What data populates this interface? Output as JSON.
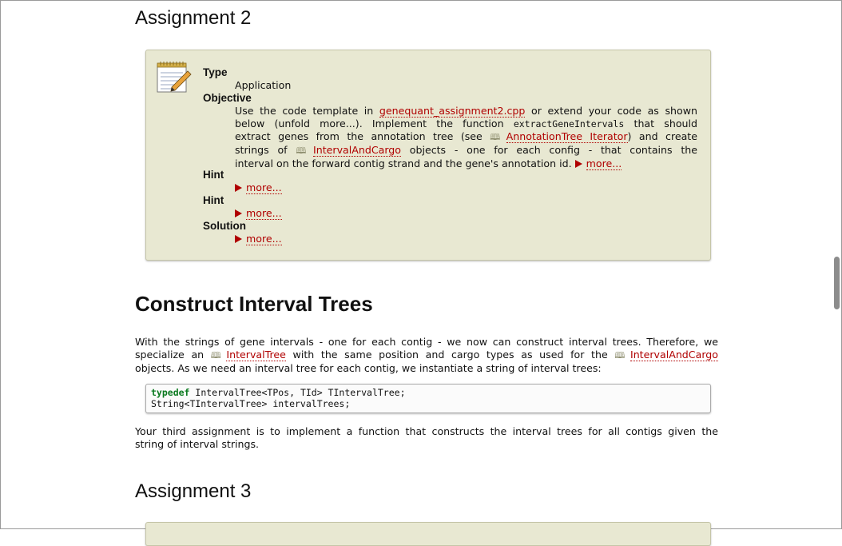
{
  "headings": {
    "assignment2": "Assignment 2",
    "construct": "Construct Interval Trees",
    "assignment3": "Assignment 3"
  },
  "assignment2": {
    "type_label": "Type",
    "type_value": "Application",
    "objective_label": "Objective",
    "objective": {
      "l1a": "Use the code template in ",
      "l1_link": "genequant_assignment2.cpp",
      "l1b": " or extend your code as shown",
      "l2a": "below (unfold more...). Implement the function ",
      "l2_code": "extractGeneIntervals",
      "l2b": " that should",
      "l3a": "extract genes from the annotation tree (see ",
      "l3_link": "AnnotationTree Iterator",
      "l3b": ") and create",
      "l4a": "strings of ",
      "l4_link": "IntervalAndCargo",
      "l4b": " objects - one for each config - that contains the",
      "l5": "interval on the forward contig strand and the gene's annotation id. ",
      "more": "more..."
    },
    "hint1_label": "Hint",
    "hint1_more": "more...",
    "hint2_label": "Hint",
    "hint2_more": "more...",
    "solution_label": "Solution",
    "solution_more": "more..."
  },
  "construct_para": {
    "l1": "With the strings of gene intervals - one for each contig - we now can construct interval trees. Therefore, we",
    "l2a": "specialize an ",
    "l2_link1": "IntervalTree",
    "l2b": " with the same position and cargo types as used for the ",
    "l2_link2": "IntervalAndCargo",
    "l3": "objects. As we need an interval tree for each contig, we instantiate a string of interval trees:"
  },
  "code": {
    "kw": "typedef",
    "line1_rest": " IntervalTree<TPos, TId> TIntervalTree;",
    "line2": "String<TIntervalTree> intervalTrees;"
  },
  "third_para": {
    "l1": "Your third assignment is to implement a function that constructs the interval trees for all contigs given the",
    "l2": "string of interval strings."
  },
  "icons": {
    "notepad": "notepad-pencil-icon",
    "book": "book-icon",
    "more_arrow": "triangle-right-icon"
  },
  "colors": {
    "box_bg": "#e8e8d2",
    "link": "#b00000",
    "keyword": "#0a7a1f"
  }
}
